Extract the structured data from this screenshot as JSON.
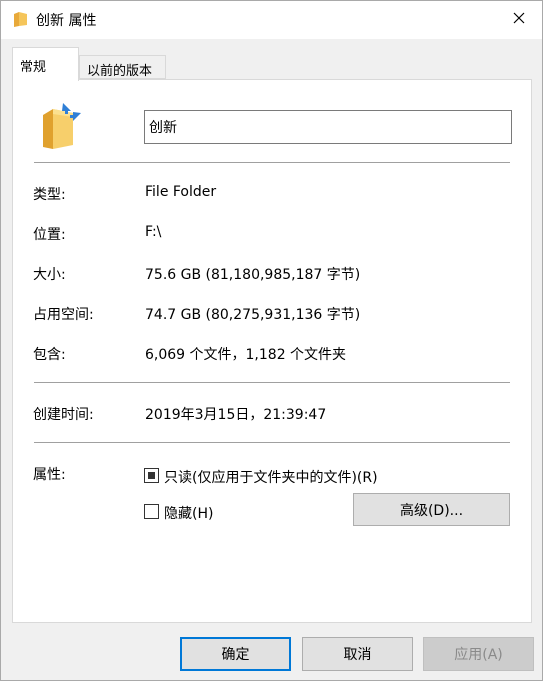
{
  "window": {
    "title": "创新 属性",
    "close_icon": "close-icon"
  },
  "tabs": [
    {
      "label": "常规",
      "active": true
    },
    {
      "label": "以前的版本",
      "active": false
    }
  ],
  "general": {
    "folder_name": "创新",
    "type_label": "类型:",
    "type_value": "File Folder",
    "location_label": "位置:",
    "location_value": "F:\\",
    "size_label": "大小:",
    "size_value": "75.6 GB (81,180,985,187 字节)",
    "size_on_disk_label": "占用空间:",
    "size_on_disk_value": "74.7 GB (80,275,931,136 字节)",
    "contains_label": "包含:",
    "contains_value": "6,069 个文件，1,182 个文件夹",
    "created_label": "创建时间:",
    "created_value": "2019年3月15日，21:39:47",
    "attributes_label": "属性:",
    "readonly_label": "只读(仅应用于文件夹中的文件)(R)",
    "readonly_state": "indeterminate",
    "hidden_label": "隐藏(H)",
    "hidden_checked": false,
    "advanced_button": "高级(D)..."
  },
  "footer": {
    "ok": "确定",
    "cancel": "取消",
    "apply": "应用(A)"
  },
  "colors": {
    "accent": "#0078d7",
    "folder": "#f5c55a",
    "panel_bg": "#ffffff",
    "window_bg": "#f0f0f0"
  }
}
